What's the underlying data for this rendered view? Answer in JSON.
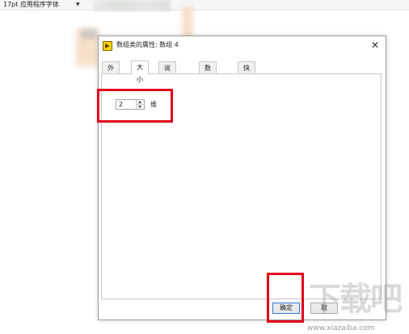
{
  "toolbar": {
    "font_select": "17pt 应用程序字体",
    "dropdown_glyph": "▼"
  },
  "dialog": {
    "title": "数组类的属性: 数组 4",
    "close_glyph": "✕",
    "tabs": [
      {
        "label": "外观"
      },
      {
        "label": "大小"
      },
      {
        "label": "说明信息"
      },
      {
        "label": "数据绑定"
      },
      {
        "label": "快捷键"
      }
    ],
    "active_tab": "大小",
    "dimension": {
      "value": "2",
      "unit": "维"
    },
    "buttons": {
      "ok": "确定",
      "cancel": "取"
    }
  },
  "watermark": {
    "text": "下载吧",
    "url": "www.xiazaiba.com"
  },
  "colors": {
    "highlight": "#e0001b",
    "ok_border": "#2f7bd6",
    "app_icon": "#ffd400"
  }
}
